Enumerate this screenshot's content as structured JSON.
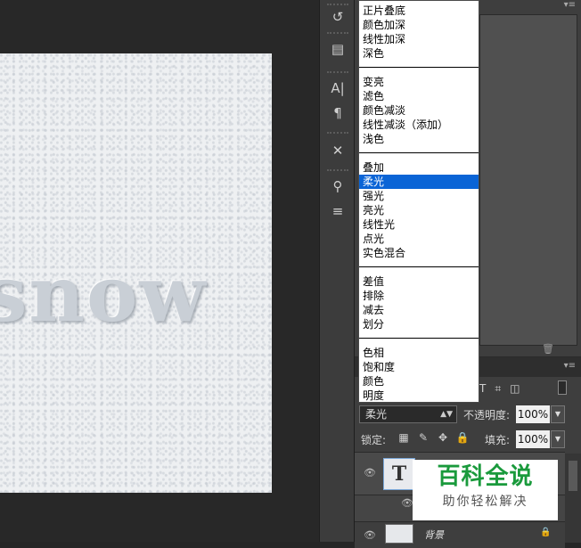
{
  "blend_menu": {
    "groups": [
      [
        "正片叠底",
        "颜色加深",
        "线性加深",
        "深色"
      ],
      [
        "变亮",
        "滤色",
        "颜色减淡",
        "线性减淡（添加）",
        "浅色"
      ],
      [
        "叠加",
        "柔光",
        "强光",
        "亮光",
        "线性光",
        "点光",
        "实色混合"
      ],
      [
        "差值",
        "排除",
        "减去",
        "划分"
      ],
      [
        "色相",
        "饱和度",
        "颜色",
        "明度"
      ]
    ],
    "selected": "柔光"
  },
  "canvas": {
    "text": "snow"
  },
  "toolbar": {
    "icons": [
      "history-icon",
      "layer-comps-icon",
      "character-icon",
      "paragraph-icon",
      "tools-icon",
      "brushes-icon",
      "adjust-icon"
    ]
  },
  "layers_panel": {
    "blend_mode": "柔光",
    "opacity_label": "不透明度:",
    "opacity_value": "100%",
    "lock_label": "锁定:",
    "fill_label": "填充:",
    "fill_value": "100%",
    "text_layer_thumb": "T",
    "background_layer_name": "背景"
  },
  "watermark": {
    "title": "百科全说",
    "subtitle": "助你轻松解决"
  }
}
